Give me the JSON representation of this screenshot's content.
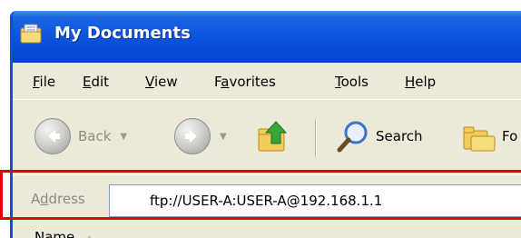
{
  "window": {
    "title": "My Documents",
    "title_icon": "folder-documents-icon"
  },
  "menu": {
    "items": [
      {
        "label": "File",
        "underline": "F",
        "rest": "ile"
      },
      {
        "label": "Edit",
        "underline": "E",
        "rest": "dit"
      },
      {
        "label": "View",
        "underline": "V",
        "rest": "iew"
      },
      {
        "label": "Favorites",
        "pre": "F",
        "underline": "a",
        "rest": "vorites"
      },
      {
        "label": "Tools",
        "underline": "T",
        "rest": "ools"
      },
      {
        "label": "Help",
        "underline": "H",
        "rest": "elp"
      }
    ]
  },
  "toolbar": {
    "back_label": "Back",
    "search_label": "Search",
    "folders_label_visible": "Fo",
    "icons": [
      "back-arrow-icon",
      "forward-arrow-icon",
      "up-folder-icon",
      "search-magnifier-icon",
      "folders-icon"
    ]
  },
  "address": {
    "label_underline": "d",
    "label_pre": "A",
    "label_post": "dress",
    "value": "ftp://USER-A:USER-A@192.168.1.1"
  },
  "list": {
    "name_column": "Name"
  },
  "colors": {
    "titlebar": "#0a54df",
    "chrome": "#ece9d8",
    "highlight": "#e00000"
  }
}
